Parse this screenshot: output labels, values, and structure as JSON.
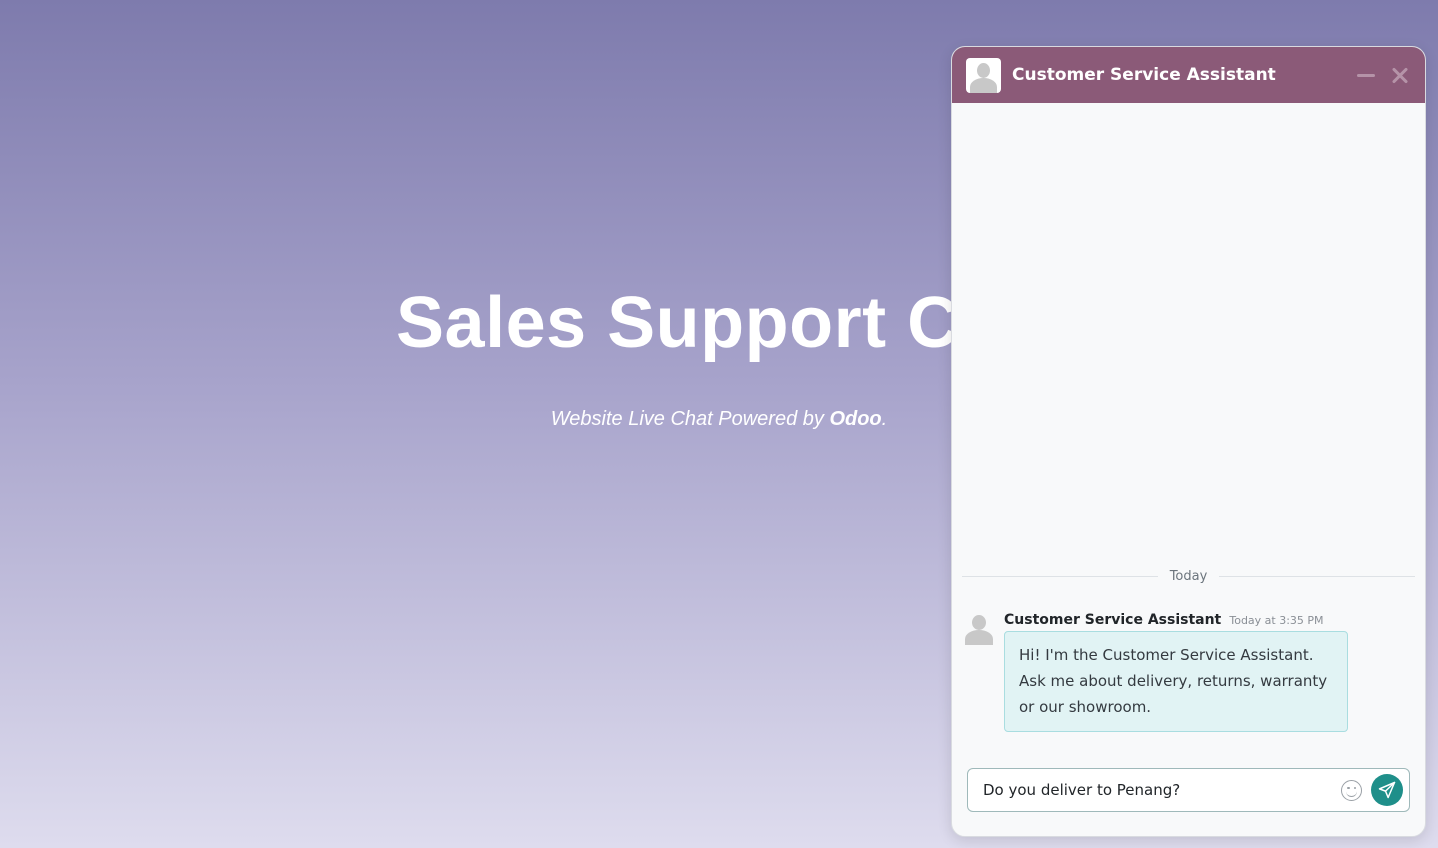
{
  "hero": {
    "title": "Sales Support Cl",
    "subtitle_prefix": "Website Live Chat Powered by ",
    "subtitle_brand": "Odoo",
    "subtitle_suffix": "."
  },
  "chat": {
    "header_title": "Customer Service Assistant",
    "day_separator": "Today",
    "messages": [
      {
        "author": "Customer Service Assistant",
        "time": "Today at 3:35 PM",
        "text": "Hi! I'm the Customer Service Assistant. Ask me about delivery, returns, warranty or our showroom."
      }
    ],
    "composer_value": "Do you deliver to Penang?",
    "colors": {
      "header": "#8b5a78",
      "bubble": "#e1f3f4",
      "send": "#1f8f8a"
    },
    "icons": [
      "avatar-icon",
      "minimize-icon",
      "close-icon",
      "emoji-icon",
      "paper-plane-icon"
    ]
  }
}
